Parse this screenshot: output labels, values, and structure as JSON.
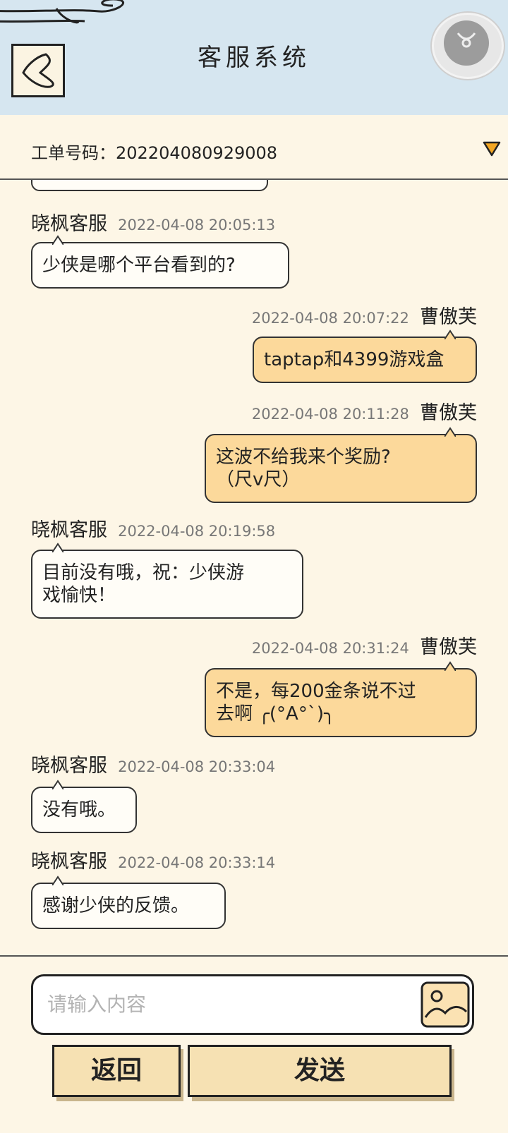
{
  "header": {
    "title": "客服系统"
  },
  "order": {
    "label": "工单号码：",
    "number": "202204080929008"
  },
  "messages": [
    {
      "side": "cs",
      "name": "晓枫客服",
      "time": "2022-04-08 20:05:13",
      "lines": [
        "少侠是哪个平台看到的?"
      ]
    },
    {
      "side": "me",
      "name": "曹傲芙",
      "time": "2022-04-08 20:07:22",
      "lines": [
        "taptap和4399游戏盒"
      ]
    },
    {
      "side": "me",
      "name": "曹傲芙",
      "time": "2022-04-08 20:11:28",
      "lines": [
        "这波不给我来个奖励?",
        "（尺v尺）"
      ]
    },
    {
      "side": "cs",
      "name": "晓枫客服",
      "time": "2022-04-08 20:19:58",
      "lines": [
        "目前没有哦，祝：少侠游",
        "戏愉快！"
      ]
    },
    {
      "side": "me",
      "name": "曹傲芙",
      "time": "2022-04-08 20:31:24",
      "lines": [
        "不是，每200金条说不过",
        "去啊 ╭(°A°`)╮"
      ]
    },
    {
      "side": "cs",
      "name": "晓枫客服",
      "time": "2022-04-08 20:33:04",
      "lines": [
        "没有哦。"
      ]
    },
    {
      "side": "cs",
      "name": "晓枫客服",
      "time": "2022-04-08 20:33:14",
      "lines": [
        "感谢少侠的反馈。"
      ]
    }
  ],
  "input": {
    "placeholder": "请输入内容"
  },
  "buttons": {
    "back": "返回",
    "send": "发送"
  }
}
